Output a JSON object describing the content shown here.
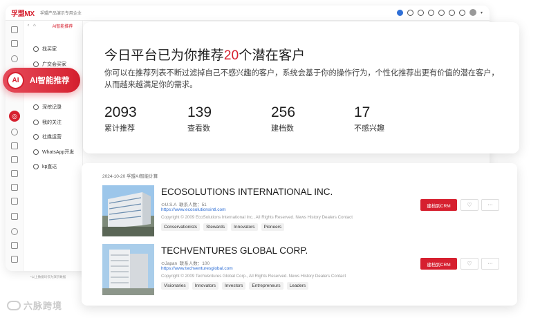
{
  "app": {
    "brand": "孚盟MX",
    "company": "孚盟产品演示专用企业",
    "topbar_icons": [
      "chat-icon",
      "link-icon",
      "headset-icon",
      "telegram-icon",
      "whatsapp-icon",
      "bell-icon",
      "help-icon",
      "user-icon"
    ]
  },
  "subnav": {
    "active_tab": "AI智能推荐",
    "items": [
      {
        "label": "找买家",
        "icon": "clock-icon"
      },
      {
        "label": "广交会买家",
        "icon": "globe-icon"
      },
      {
        "label": "深挖记录",
        "icon": "file-icon"
      },
      {
        "label": "我的关注",
        "icon": "heart-icon"
      },
      {
        "label": "社媒运营",
        "icon": "share-icon"
      },
      {
        "label": "WhatsApp开发",
        "icon": "whatsapp-icon"
      },
      {
        "label": "kp直达",
        "icon": "pin-icon"
      }
    ],
    "footnote": "*以上数据均仅为演示数据"
  },
  "ai_pill": {
    "label": "AI智能推荐",
    "icon_text": "AI"
  },
  "stats": {
    "headline_prefix": "今日平台已为你推荐",
    "headline_number": "20",
    "headline_suffix": "个潜在客户",
    "description": "你可以在推荐列表不断过滤掉自己不感兴趣的客户，系统会基于你的操作行为，个性化推荐出更有价值的潜在客户，从而越来越满足你的需求。",
    "items": [
      {
        "value": "2093",
        "label": "累计推荐"
      },
      {
        "value": "139",
        "label": "查看数"
      },
      {
        "value": "256",
        "label": "建档数"
      },
      {
        "value": "17",
        "label": "不感兴趣"
      }
    ]
  },
  "results": {
    "date_line": "2024-10-20  孚盟AI智能计算",
    "companies": [
      {
        "name": "ECOSOLUTIONS INTERNATIONAL INC.",
        "country": "U.S.A",
        "contacts": "联系人数：51",
        "url": "https://www.ecosolutionsintl.com",
        "copyright": "Copyright © 2009 EcoSolutions International Inc., All Rights Reserved. News History Dealers Contact",
        "tags": [
          "Conservationists",
          "Stewards",
          "Innovators",
          "Pioneers"
        ],
        "crm_label": "建档到CRM"
      },
      {
        "name": "TECHVENTURES GLOBAL CORP.",
        "country": "Japan",
        "contacts": "联系人数：100",
        "url": "https://www.techventuresglobal.com",
        "copyright": "Copyright © 2009 TechVentures Global Corp., All Rights Reserved. News History Dealers Contact",
        "tags": [
          "Visionaries",
          "Innovators",
          "Investors",
          "Entrepreneurs",
          "Leaders"
        ],
        "crm_label": "建档到CRM"
      }
    ]
  },
  "watermark": "六脉跨境",
  "colors": {
    "accent": "#d6202f",
    "link": "#2f6fd6"
  }
}
